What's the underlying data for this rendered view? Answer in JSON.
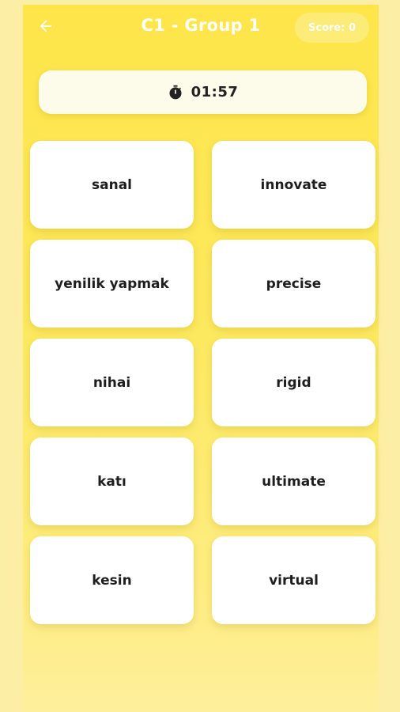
{
  "header": {
    "title": "C1 - Group 1",
    "score": "Score: 0"
  },
  "timer": {
    "value": "01:57"
  },
  "cards": [
    {
      "text": "sanal"
    },
    {
      "text": "innovate"
    },
    {
      "text": "yenilik yapmak"
    },
    {
      "text": "precise"
    },
    {
      "text": "nihai"
    },
    {
      "text": "rigid"
    },
    {
      "text": "katı"
    },
    {
      "text": "ultimate"
    },
    {
      "text": "kesin"
    },
    {
      "text": "virtual"
    }
  ],
  "colors": {
    "background": "#fdeea6",
    "header_yellow": "#fde549",
    "card": "#ffffff",
    "timer_bg": "#fdfbe9"
  }
}
